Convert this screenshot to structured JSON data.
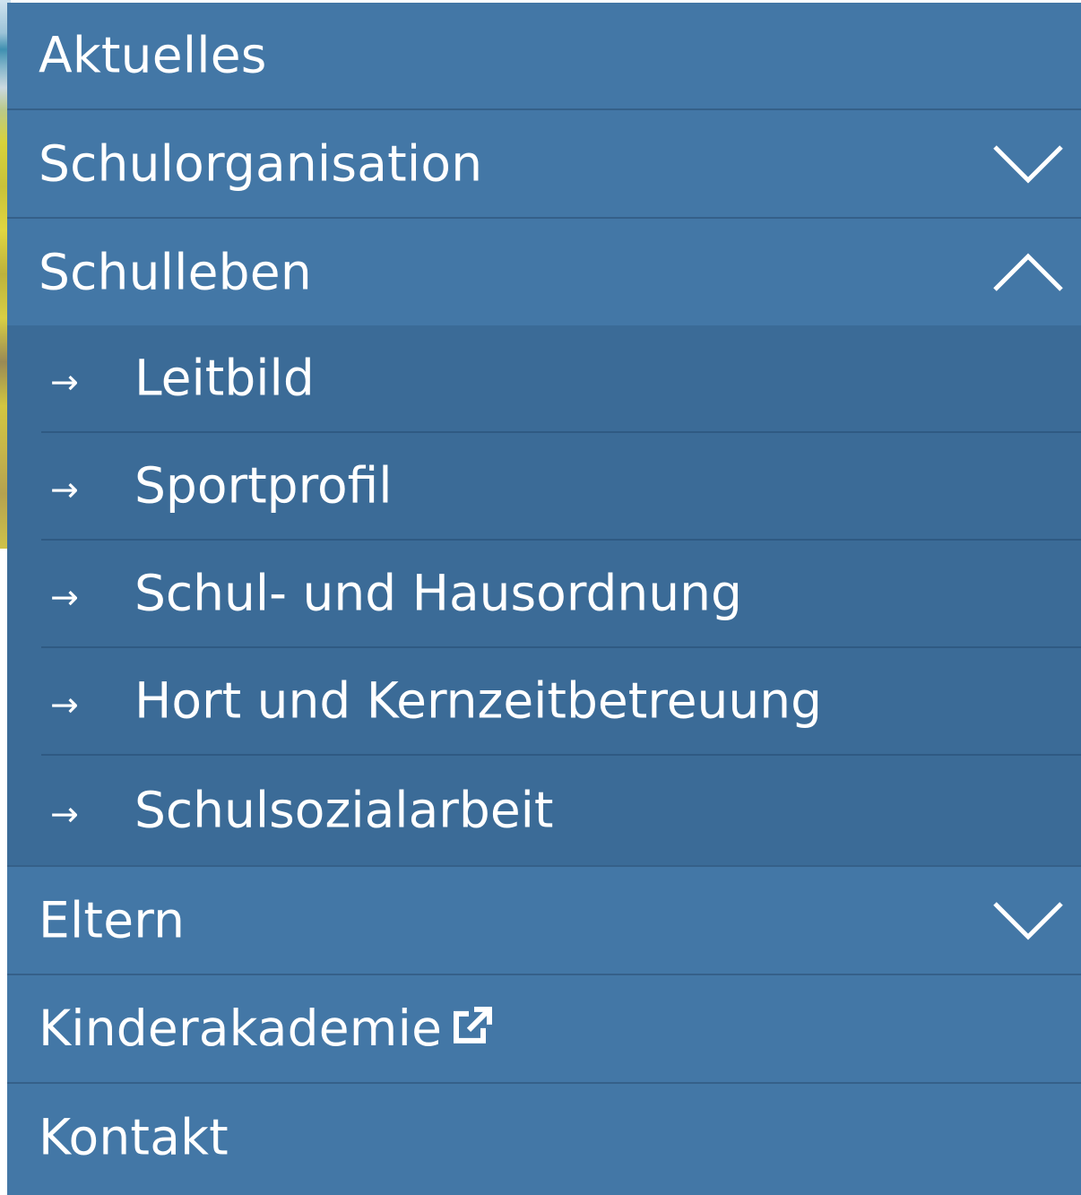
{
  "menu": {
    "items": [
      {
        "label": "Aktuelles"
      },
      {
        "label": "Schulorganisation",
        "toggle": "chevron-down"
      },
      {
        "label": "Schulleben",
        "toggle": "chevron-up",
        "expanded": true,
        "children": [
          {
            "arrow": "→",
            "label": "Leitbild"
          },
          {
            "arrow": "→",
            "label": "Sportprofil"
          },
          {
            "arrow": "→",
            "label": "Schul- und Hausordnung"
          },
          {
            "arrow": "→",
            "label": "Hort und Kernzeitbetreuung"
          },
          {
            "arrow": "→",
            "label": "Schulsozialarbeit"
          }
        ]
      },
      {
        "label": "Eltern",
        "toggle": "chevron-down"
      },
      {
        "label": "Kinderakademie",
        "icon": "external-link-icon"
      },
      {
        "label": "Kontakt"
      }
    ]
  },
  "colors": {
    "menu_background": "#4377a6",
    "submenu_background": "#3b6b97",
    "divider": "#356089",
    "text": "#ffffff"
  }
}
